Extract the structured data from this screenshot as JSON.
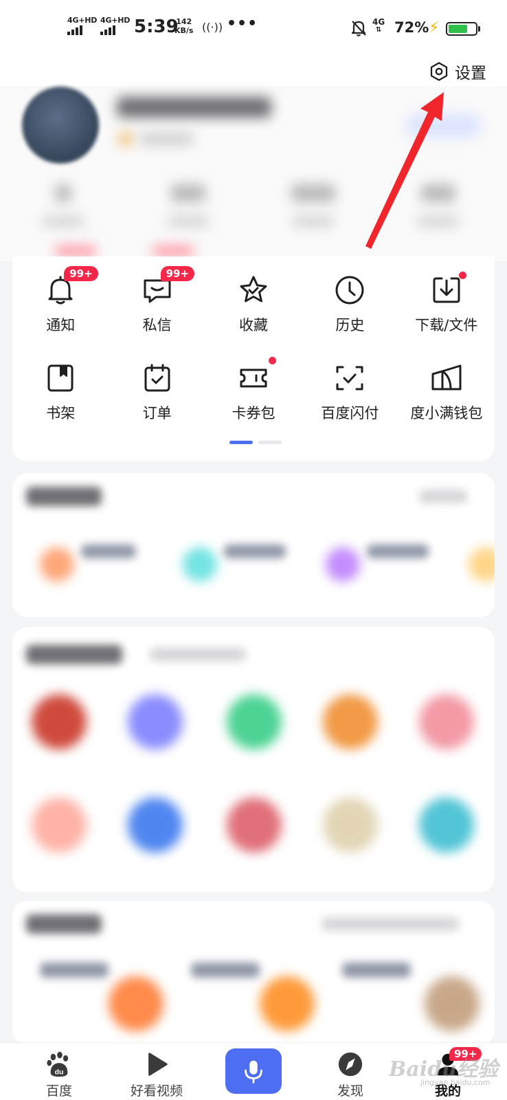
{
  "status_bar": {
    "sim1": "4G+HD",
    "sim2": "4G+HD",
    "time": "5:39",
    "speed_value": "142",
    "speed_unit": "KB/s",
    "hotspot": "((·))",
    "more": "•••",
    "net_type": "4G",
    "battery_text": "72%",
    "battery_level": 0.72,
    "battery_color": "#2fc14a",
    "charging_icon": "bolt-icon"
  },
  "header": {
    "settings_label": "设置",
    "settings_icon": "settings-icon"
  },
  "quick_menu": {
    "row1": [
      {
        "label": "通知",
        "icon": "bell-icon",
        "badge": "99+"
      },
      {
        "label": "私信",
        "icon": "message-icon",
        "badge": "99+"
      },
      {
        "label": "收藏",
        "icon": "star-icon"
      },
      {
        "label": "历史",
        "icon": "clock-icon"
      },
      {
        "label": "下载/文件",
        "icon": "download-icon",
        "dot": true
      }
    ],
    "row2": [
      {
        "label": "书架",
        "icon": "bookshelf-icon"
      },
      {
        "label": "订单",
        "icon": "order-icon"
      },
      {
        "label": "卡券包",
        "icon": "coupon-icon",
        "dot": true
      },
      {
        "label": "百度闪付",
        "icon": "scan-pay-icon"
      },
      {
        "label": "度小满钱包",
        "icon": "wallet-icon"
      }
    ],
    "page_count": 2,
    "active_page": 1
  },
  "bottom_nav": {
    "items": [
      {
        "label": "百度",
        "icon": "baidu-paw-icon"
      },
      {
        "label": "好看视频",
        "icon": "play-icon"
      },
      {
        "label": "",
        "icon": "microphone-icon"
      },
      {
        "label": "发现",
        "icon": "compass-icon"
      },
      {
        "label": "我的",
        "icon": "profile-icon",
        "badge": "99+",
        "active": true
      }
    ],
    "accent_color": "#4e6ef2"
  },
  "watermark": {
    "text": "Baidu经验",
    "sub": "jingyan.baidu.com"
  }
}
